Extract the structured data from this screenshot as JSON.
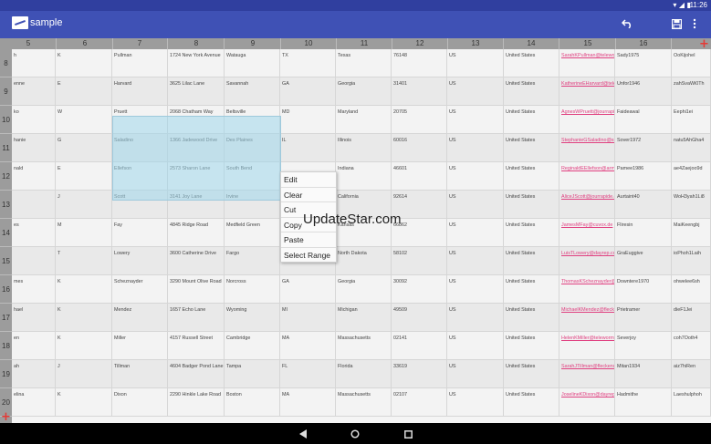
{
  "status": {
    "time": "11:26",
    "wifi_icon": "wifi-icon",
    "signal_icon": "signal-icon",
    "battery_icon": "battery-icon"
  },
  "toolbar": {
    "title": "sample",
    "undo_icon": "undo-icon",
    "save_icon": "save-icon",
    "more_icon": "more-vert-icon"
  },
  "watermark": "UpdateStar.com",
  "context_menu": [
    "Edit",
    "Clear",
    "Cut",
    "Copy",
    "Paste",
    "Select Range"
  ],
  "columns": [
    "5",
    "6",
    "7",
    "8",
    "9",
    "10",
    "11",
    "12",
    "13",
    "14",
    "15",
    "16"
  ],
  "rows": [
    {
      "num": "8",
      "cells": [
        "h",
        "K",
        "Pullman",
        "1724 New York Avenue",
        "Watauga",
        "TX",
        "Texas",
        "76148",
        "US",
        "United States",
        "SarahKPullman@teleworm.us",
        "Sady1975",
        "OoKijoheI"
      ]
    },
    {
      "num": "9",
      "cells": [
        "enne",
        "E",
        "Harvard",
        "3625 Lilac Lane",
        "Savannah",
        "GA",
        "Georgia",
        "31401",
        "US",
        "United States",
        "KatherineEHarvard@teleworm.us",
        "Unfor1946",
        "zahSvaWi0Th"
      ]
    },
    {
      "num": "10",
      "cells": [
        "ko",
        "W",
        "Pruett",
        "2068 Chatham Way",
        "Beltsville",
        "MD",
        "Maryland",
        "20705",
        "US",
        "United States",
        "AgnesWPruett@jourrapide.com",
        "Faideawal",
        "Eephi1ei"
      ]
    },
    {
      "num": "11",
      "cells": [
        "hanie",
        "G",
        "Saladino",
        "1366 Jadewood Drive",
        "Des Plaines",
        "IL",
        "Illinois",
        "60016",
        "US",
        "United States",
        "StephanieGSaladino@superrito.com",
        "Sover1972",
        "natu5AhGha4"
      ]
    },
    {
      "num": "12",
      "cells": [
        "nald",
        "E",
        "Ellefson",
        "2573 Sharon Lane",
        "South Bend",
        "",
        "Indiana",
        "46601",
        "US",
        "United States",
        "ReginaldEEllefson@armyspy.com",
        "Pamee1986",
        "ae4Zaejoo9d"
      ]
    },
    {
      "num": "13",
      "cells": [
        "",
        "J",
        "Scott",
        "3141 Joy Lane",
        "Irvine",
        "",
        "California",
        "92614",
        "US",
        "United States",
        "AliceJScott@jourrapide.com",
        "Aurtaint40",
        "WoH3yah1Li8"
      ]
    },
    {
      "num": "14",
      "cells": [
        "es",
        "M",
        "Fay",
        "4845 Ridge Road",
        "Medfield Green",
        "",
        "Kansas",
        "66862",
        "US",
        "United States",
        "JamesMFay@cuvox.de",
        "Fliresin",
        "MaiKeengbj"
      ]
    },
    {
      "num": "15",
      "cells": [
        "",
        "T",
        "Lowery",
        "3600 Catherine Drive",
        "Fargo",
        "",
        "North Dakota",
        "58102",
        "US",
        "United States",
        "LuisTLowery@dayrep.com",
        "GraEuggive",
        "ioPhoh1Laih"
      ]
    },
    {
      "num": "16",
      "cells": [
        "mes",
        "K",
        "Scheznayder",
        "3290 Mount Olive Road",
        "Norcross",
        "GA",
        "Georgia",
        "30092",
        "US",
        "United States",
        "ThomasKScheznayder@rhyta.com",
        "Downtere1970",
        "ohwelee6sh"
      ]
    },
    {
      "num": "17",
      "cells": [
        "hael",
        "K",
        "Mendez",
        "1657 Echo Lane",
        "Wyoming",
        "MI",
        "Michigan",
        "49509",
        "US",
        "United States",
        "MichaelKMendez@fleckens.hu",
        "Prietramer",
        "dieF1Jei"
      ]
    },
    {
      "num": "18",
      "cells": [
        "en",
        "K",
        "Miller",
        "4157 Russell Street",
        "Cambridge",
        "MA",
        "Massachusetts",
        "02141",
        "US",
        "United States",
        "HelenKMiller@teleworm.us",
        "Severjoy",
        "coh7Ooth4"
      ]
    },
    {
      "num": "19",
      "cells": [
        "ah",
        "J",
        "Tillman",
        "4604 Badger Pond Lane",
        "Tampa",
        "FL",
        "Florida",
        "33619",
        "US",
        "United States",
        "SarahJTillman@fleckens.hu",
        "Mitan1934",
        "aiz7hiRen"
      ]
    },
    {
      "num": "20",
      "cells": [
        "elina",
        "K",
        "Dixon",
        "2290 Hinkle Lake Road",
        "Boston",
        "MA",
        "Massachusetts",
        "02107",
        "US",
        "United States",
        "JoselineKDixon@dayrep.com",
        "Hadmithe",
        "Laeshulphoh"
      ]
    }
  ],
  "nav": {
    "back_icon": "back-triangle-icon",
    "home_icon": "home-circle-icon",
    "recents_icon": "recents-square-icon"
  }
}
